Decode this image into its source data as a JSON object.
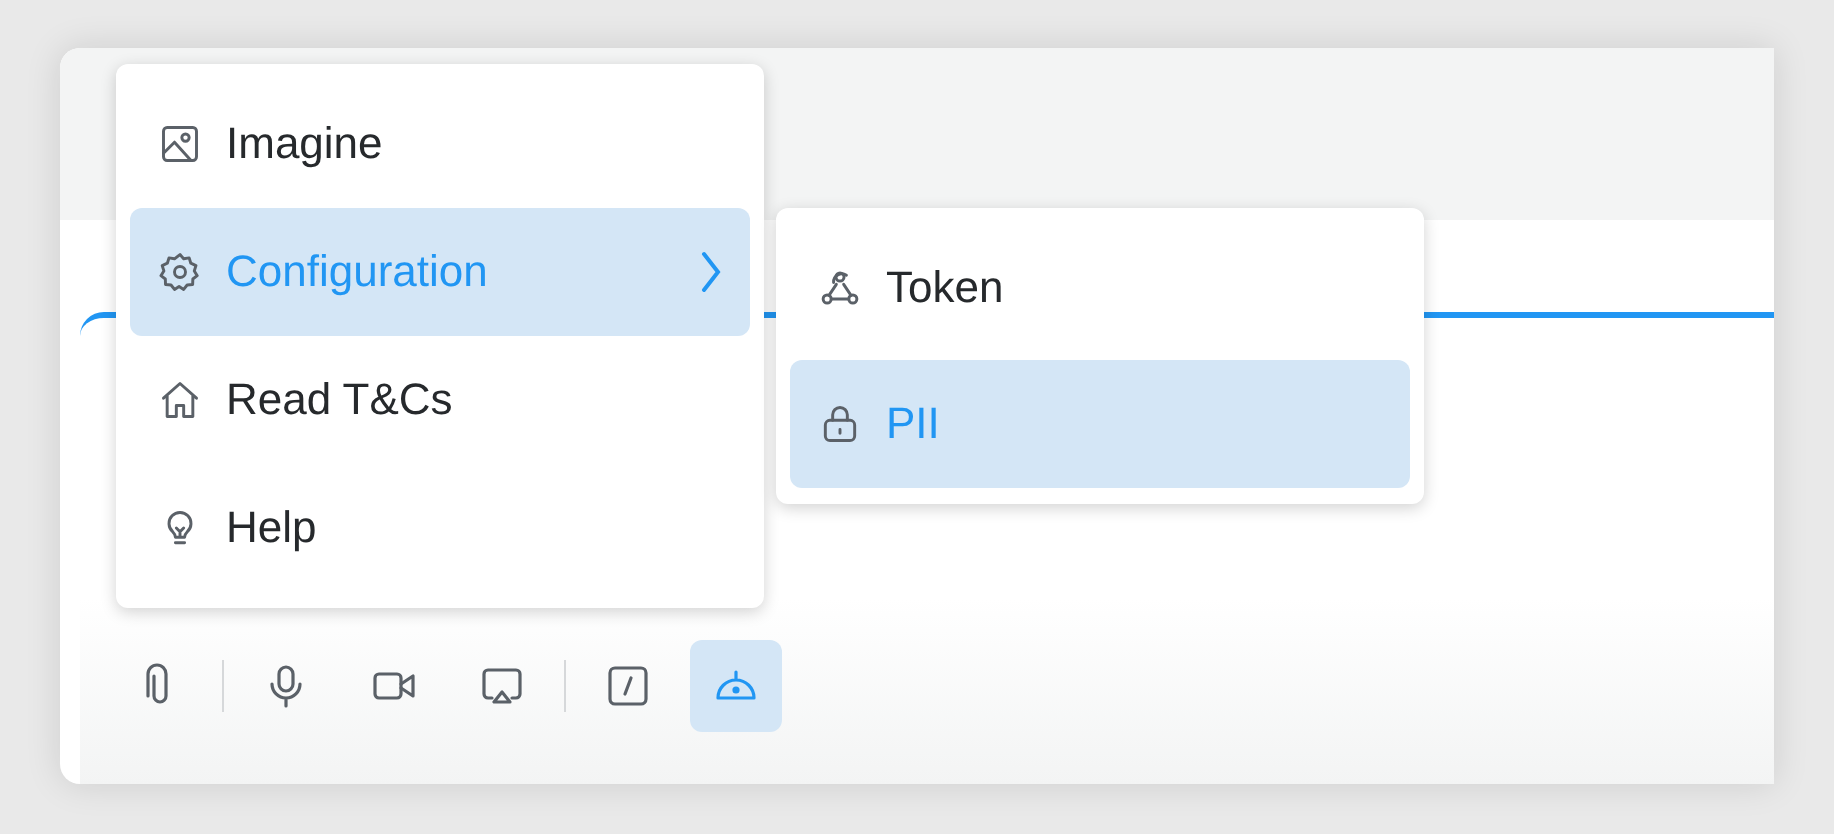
{
  "menu": {
    "items": [
      {
        "label": "Imagine",
        "selected": false,
        "submenu": false
      },
      {
        "label": "Configuration",
        "selected": true,
        "submenu": true
      },
      {
        "label": "Read T&Cs",
        "selected": false,
        "submenu": false
      },
      {
        "label": "Help",
        "selected": false,
        "submenu": false
      }
    ]
  },
  "submenu": {
    "items": [
      {
        "label": "Token",
        "selected": false
      },
      {
        "label": "PII",
        "selected": true
      }
    ]
  },
  "toolbar": {
    "groups": [
      [
        {
          "selected": false
        }
      ],
      [
        {
          "selected": false
        },
        {
          "selected": false
        },
        {
          "selected": false
        }
      ],
      [
        {
          "selected": false
        },
        {
          "selected": true
        }
      ]
    ]
  }
}
